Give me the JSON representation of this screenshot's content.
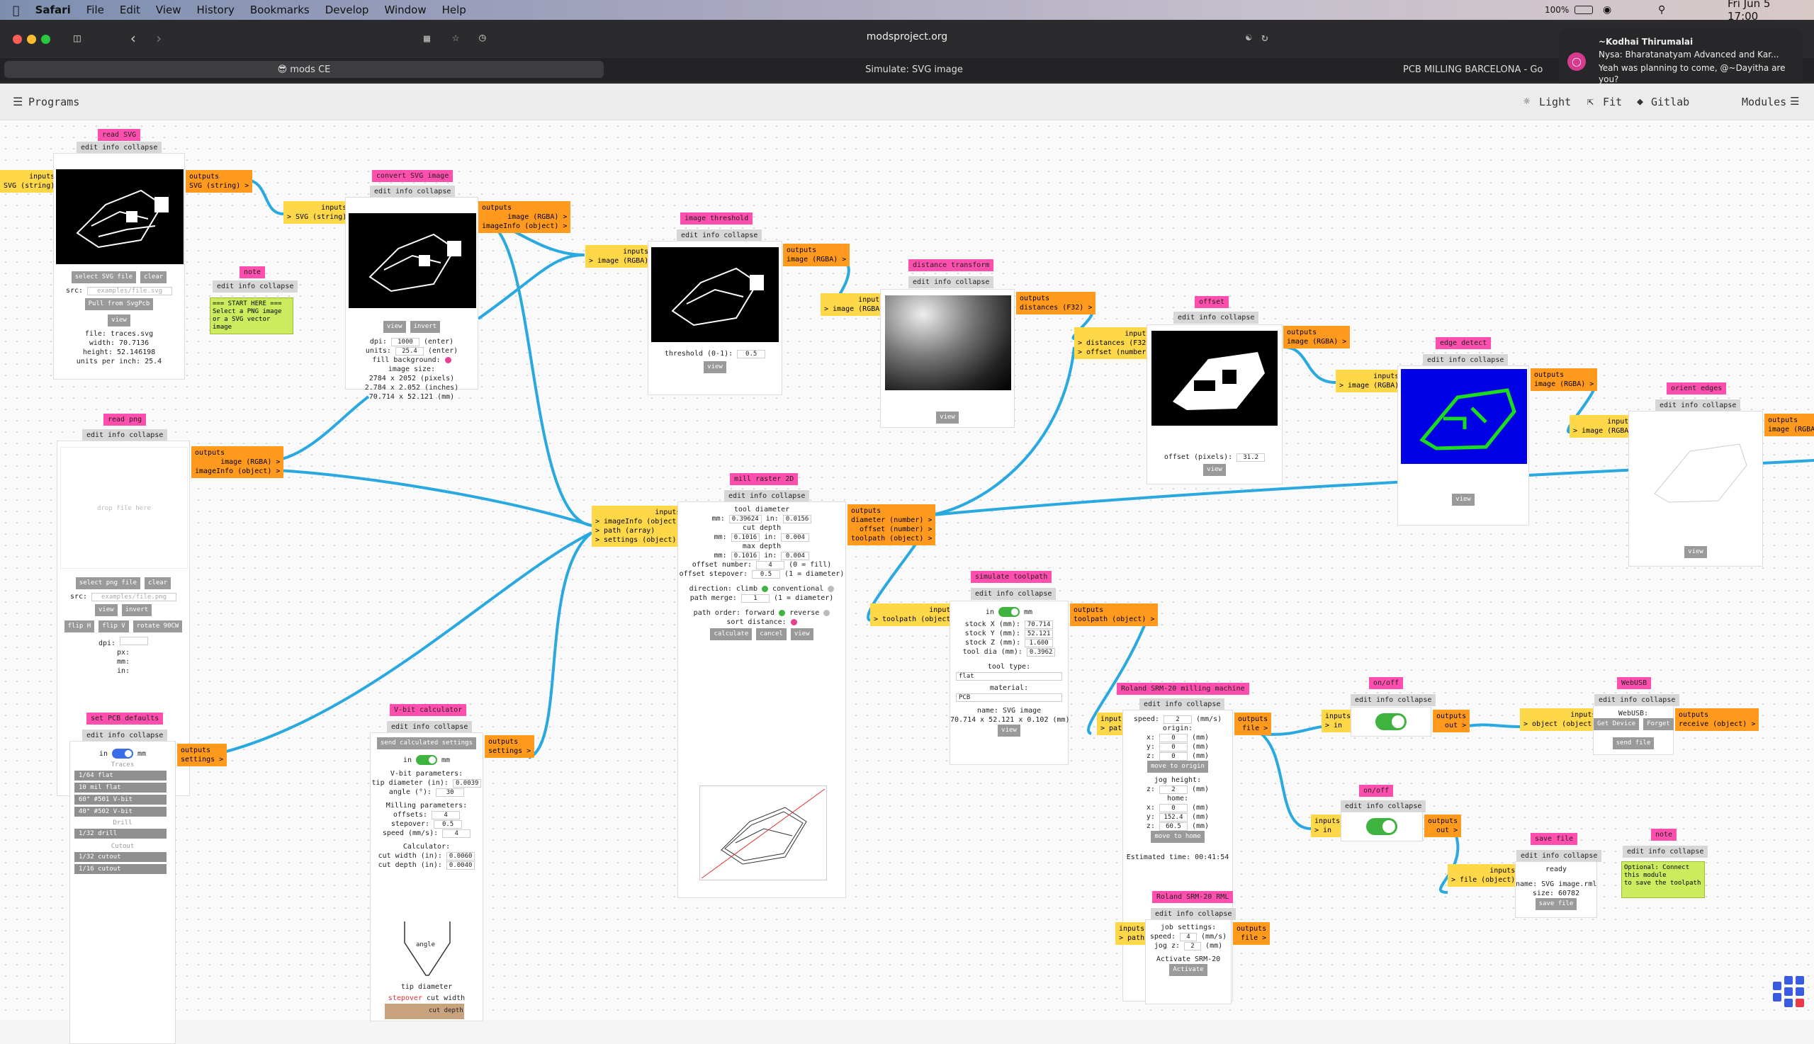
{
  "menubar": {
    "apple": "",
    "items": [
      "Safari",
      "File",
      "Edit",
      "View",
      "History",
      "Bookmarks",
      "Develop",
      "Window",
      "Help"
    ],
    "battery": "100%",
    "datetime": "Fri Jun 5  17:00"
  },
  "browser": {
    "url": "modsproject.org",
    "tabs": [
      "😎 mods CE",
      "Simulate: SVG image",
      "PCB MILLING BARCELONA - Go"
    ]
  },
  "notification": {
    "sender": "~Kodhai Thirumalai",
    "title": "Nysa: Bharatanatyam Advanced  and Kar...",
    "message": "Yeah was planning to come, @~Dayitha are you?"
  },
  "toolbar": {
    "programs": "Programs",
    "light": "Light",
    "fit": "Fit",
    "gitlab": "Gitlab",
    "modules": "Modules"
  },
  "mods": {
    "readsvg": {
      "title": "read SVG",
      "bar": "edit info collapse",
      "inputs": "inputs",
      "in1": "SVG (string)",
      "outputs": "outputs",
      "out1": "SVG (string) >",
      "select": "select SVG file",
      "clear": "clear",
      "src_label": "src:",
      "src_ph": "examples/file.svg",
      "pull": "Pull from SvgPcb",
      "view": "view",
      "file": "file: traces.svg",
      "width": "width: 70.7136",
      "height": "height: 52.146198",
      "upi": "units per inch: 25.4"
    },
    "convert": {
      "title": "convert SVG image",
      "bar": "edit info collapse",
      "inputs": "inputs",
      "in1": "> SVG (string)",
      "outputs": "outputs",
      "out1": "image (RGBA) >",
      "out2": "imageInfo (object) >",
      "view": "view",
      "invert": "invert",
      "dpi": "dpi:",
      "dpi_v": "1000",
      "dpi_u": "(enter)",
      "units": "units:",
      "units_v": "25.4",
      "units_u": "(enter)",
      "fill": "fill background:",
      "size": "image size:",
      "px": "2784 x 2052 (pixels)",
      "in": "2.784 x 2.052 (inches)",
      "mm": "70.714 x 52.121 (mm)"
    },
    "note1": {
      "title": "note",
      "bar": "edit info collapse",
      "text": "=== START HERE ===\nSelect a PNG image or a SVG vector image"
    },
    "readpng": {
      "title": "read png",
      "bar": "edit info collapse",
      "outputs": "outputs",
      "out1": "image (RGBA) >",
      "out2": "imageInfo (object) >",
      "drop": "drop file here",
      "select": "select png file",
      "clear": "clear",
      "src_label": "src:",
      "src_ph": "examples/file.png",
      "view": "view",
      "invert": "invert",
      "flipH": "flip H",
      "flipV": "flip V",
      "rotate": "rotate 90CW",
      "dpi": "dpi:",
      "px": "px:",
      "mm": "mm:",
      "in": "in:"
    },
    "threshold": {
      "title": "image threshold",
      "bar": "edit info collapse",
      "inputs": "inputs",
      "in1": "> image (RGBA)",
      "outputs": "outputs",
      "out1": "image (RGBA) >",
      "label": "threshold (0-1):",
      "value": "0.5",
      "view": "view"
    },
    "distance": {
      "title": "distance transform",
      "bar": "edit info collapse",
      "inputs": "inputs",
      "in1": "> image (RGBA)",
      "outputs": "outputs",
      "out1": "distances (F32) >",
      "view": "view"
    },
    "offset": {
      "title": "offset",
      "bar": "edit info collapse",
      "inputs": "inputs",
      "in1": "> distances (F32)",
      "in2": "> offset (number)",
      "outputs": "outputs",
      "out1": "image (RGBA) >",
      "label": "offset (pixels):",
      "value": "31.2",
      "view": "view"
    },
    "edge": {
      "title": "edge detect",
      "bar": "edit info collapse",
      "inputs": "inputs",
      "in1": "> image (RGBA)",
      "outputs": "outputs",
      "out1": "image (RGBA) >",
      "view": "view"
    },
    "orient": {
      "title": "orient edges",
      "bar": "edit info collapse",
      "inputs": "inputs",
      "in1": "> image (RGBA)",
      "outputs": "outputs",
      "out1": "image (RGBA)",
      "view": "view"
    },
    "mill": {
      "title": "mill raster 2D",
      "bar": "edit info collapse",
      "inputs": "inputs",
      "in1": "> imageInfo (object)",
      "in2": "> path (array)",
      "in3": "> settings (object)",
      "outputs": "outputs",
      "out1": "diameter (number) >",
      "out2": "offset (number) >",
      "out3": "toolpath (object) >",
      "tool": "tool diameter",
      "mm1": "mm:",
      "mm1v": "0.39624",
      "in1l": "in:",
      "in1v": "0.0156",
      "cut": "cut depth",
      "mm2v": "0.1016",
      "in2v": "0.004",
      "max": "max depth",
      "mm3v": "0.1016",
      "in3v": "0.004",
      "offnum": "offset number:",
      "offnum_v": "4",
      "offnum_u": "(0 = fill)",
      "stepover": "offset stepover:",
      "stepover_v": "0.5",
      "stepover_u": "(1 = diameter)",
      "direction": "direction: climb",
      "conventional": "conventional",
      "merge": "path merge:",
      "merge_v": "1",
      "merge_u": "(1 = diameter)",
      "order": "path order: forward",
      "reverse": "reverse",
      "sort": "sort distance:",
      "calculate": "calculate",
      "cancel": "cancel",
      "view": "view"
    },
    "simulate": {
      "title": "simulate toolpath",
      "bar": "edit info collapse",
      "inputs": "inputs",
      "in1": "> toolpath (object)",
      "outputs": "outputs",
      "out1": "toolpath (object) >",
      "in": "in",
      "mm": "mm",
      "sx": "stock X (mm):",
      "sx_v": "70.714",
      "sy": "stock Y (mm):",
      "sy_v": "52.121",
      "sz": "stock Z (mm):",
      "sz_v": "1.600",
      "td": "tool dia (mm):",
      "td_v": "0.3962",
      "ttype": "tool type:",
      "ttype_v": "flat",
      "material": "material:",
      "material_v": "PCB",
      "name": "name: SVG image",
      "dims": "70.714 x 52.121 x 0.102 (mm)",
      "view": "view"
    },
    "pcb": {
      "title": "set PCB defaults",
      "bar": "edit info collapse",
      "outputs": "outputs",
      "out1": "settings >",
      "in": "in",
      "mm": "mm",
      "traces": "Traces",
      "t1": "1/64 flat",
      "t2": "10 mil flat",
      "t3": "60° #501 V-bit",
      "t4": "40° #502 V-bit",
      "drill": "Drill",
      "d1": "1/32 drill",
      "cutout": "Cutout",
      "c1": "1/32 cutout",
      "c2": "1/16 cutout"
    },
    "vbit": {
      "title": "V-bit calculator",
      "bar": "edit info collapse",
      "outputs": "outputs",
      "out1": "settings >",
      "send": "send calculated settings",
      "in": "in",
      "mm": "mm",
      "vparams": "V-bit parameters:",
      "tip": "tip diameter (in):",
      "tip_v": "0.0039",
      "angle": "angle (°):",
      "angle_v": "30",
      "mparams": "Milling parameters:",
      "offsets": "offsets:",
      "offsets_v": "4",
      "stepover": "stepover:",
      "stepover_v": "0.5",
      "speed": "speed (mm/s):",
      "speed_v": "4",
      "calc": "Calculator:",
      "cw": "cut width (in):",
      "cw_v": "0.0060",
      "cd": "cut depth (in):",
      "cd_v": "0.0040",
      "angle_lbl": "angle",
      "tipd": "tip diameter",
      "stepover_lbl": "stepover",
      "cutwidth": "cut width",
      "cutdepth": "cut depth"
    },
    "roland": {
      "title": "Roland SRM-20 milling machine",
      "bar": "edit info collapse",
      "inputs": "inputs",
      "in1": "> path",
      "outputs": "outputs",
      "out1": "file >",
      "speed": "speed:",
      "speed_v": "2",
      "speed_u": "(mm/s)",
      "origin": "origin:",
      "x": "x:",
      "xv": "0",
      "y": "y:",
      "yv": "0",
      "z": "z:",
      "zv": "0",
      "u": "(mm)",
      "move_origin": "move to origin",
      "jog": "jog height:",
      "jog_v": "2",
      "home": "home:",
      "hx": "0",
      "hy": "152.4",
      "hz": "60.5",
      "move_home": "move to home",
      "estimate": "Estimated time: 00:41:54"
    },
    "rml": {
      "title": "Roland SRM-20 RML",
      "bar": "edit info collapse",
      "inputs": "inputs",
      "in1": "> path",
      "outputs": "outputs",
      "out1": "file >",
      "job": "job settings:",
      "speed": "speed:",
      "speed_v": "4",
      "speed_u": "(mm/s)",
      "jogz": "jog z:",
      "jogz_v": "2",
      "jogz_u": "(mm)",
      "activate": "Activate SRM-20",
      "act_btn": "Activate"
    },
    "onoff1": {
      "title": "on/off",
      "bar": "edit info collapse",
      "inputs": "inputs",
      "in1": "> in",
      "outputs": "outputs",
      "out1": "out >"
    },
    "onoff2": {
      "title": "on/off",
      "bar": "edit info collapse",
      "inputs": "inputs",
      "in1": "> in",
      "outputs": "outputs",
      "out1": "out >"
    },
    "webusb": {
      "title": "WebUSB",
      "bar": "edit info collapse",
      "inputs": "inputs",
      "in1": "> object (object)",
      "outputs": "outputs",
      "out1": "receive (object) >",
      "label": "WebUSB:",
      "get": "Get Device",
      "forget": "Forget",
      "send": "send file"
    },
    "save": {
      "title": "save file",
      "bar": "edit info collapse",
      "inputs": "inputs",
      "in1": "> file (object)",
      "ready": "ready",
      "name": "name: SVG image.rml",
      "size": "size: 60782",
      "btn": "save file"
    },
    "note2": {
      "title": "note",
      "bar": "edit info collapse",
      "text": "Optional: Connect this module\nto save the toolpath"
    }
  },
  "colors": {
    "title": "#ff4fae",
    "input": "#ffd84a",
    "output": "#ff9a1f",
    "wire": "#29a9e0",
    "note": "#cdeb5e"
  }
}
